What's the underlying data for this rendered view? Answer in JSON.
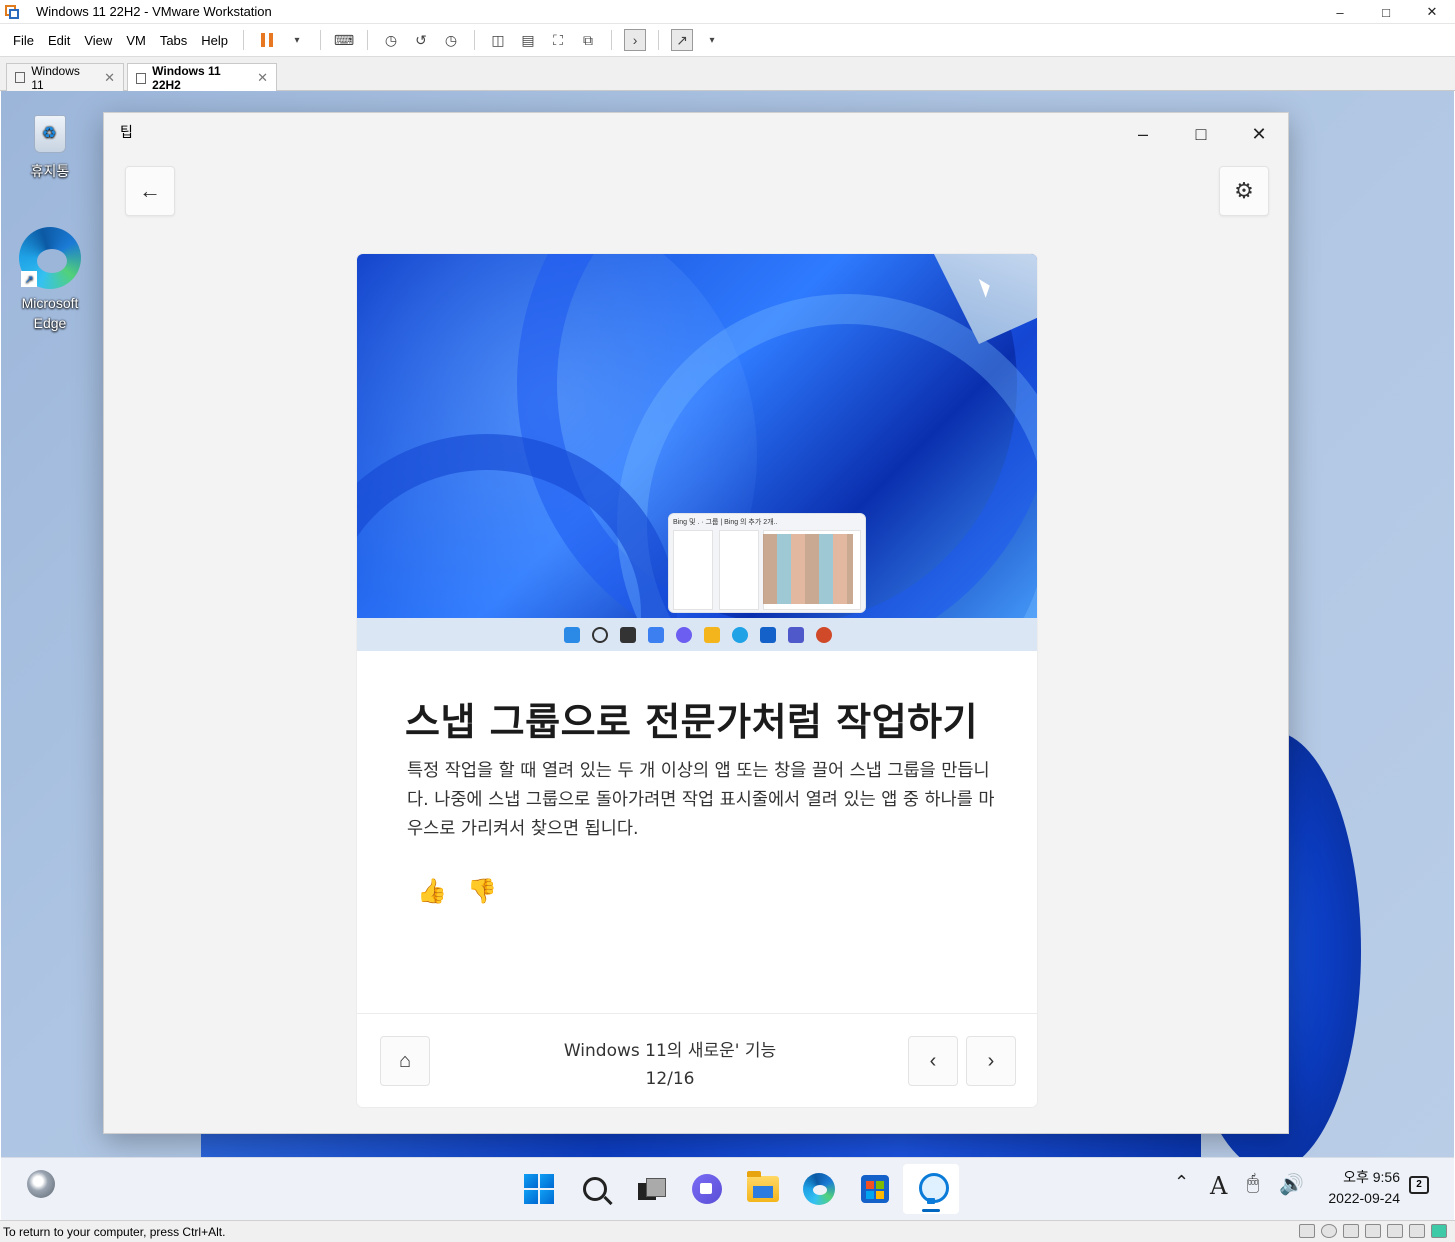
{
  "vmware": {
    "window_title": "Windows 11 22H2 - VMware Workstation",
    "menu": [
      "File",
      "Edit",
      "View",
      "VM",
      "Tabs",
      "Help"
    ],
    "tabs": [
      {
        "label": "Windows 11",
        "active": false
      },
      {
        "label": "Windows 11 22H2",
        "active": true
      }
    ],
    "status_text": "To return to your computer, press Ctrl+Alt."
  },
  "desktop": {
    "icons": [
      {
        "label": "휴지통",
        "icon": "recycle-bin-icon"
      },
      {
        "label": "Microsoft Edge",
        "icon": "edge-icon"
      }
    ]
  },
  "tips_app": {
    "window_title": "팁",
    "hero_popup_header": "Bing 및 .  ·  그룹  |  Bing 의 추가 2개..",
    "card_title": "스냅 그룹으로 전문가처럼 작업하기",
    "card_body": "특정 작업을 할 때 열려 있는 두 개 이상의 앱 또는 창을 끌어 스냅 그룹을 만듭니다. 나중에 스냅 그룹으로 돌아가려면 작업 표시줄에서 열려 있는 앱 중 하나를 마우스로 가리켜서 찾으면 됩니다.",
    "footer_category": "Windows 11의 새로운' 기능",
    "footer_page": "12/16"
  },
  "taskbar": {
    "apps": [
      "start-icon",
      "search-icon",
      "task-view-icon",
      "chat-icon",
      "file-explorer-icon",
      "edge-icon",
      "store-icon",
      "tips-icon"
    ],
    "active_app": "tips-icon",
    "clock_time": "오후 9:56",
    "clock_date": "2022-09-24",
    "ime_indicator": "A"
  },
  "colors": {
    "accent": "#0067c0",
    "vm_pause": "#e87722",
    "bloom_blue": "#0b3bbf"
  }
}
